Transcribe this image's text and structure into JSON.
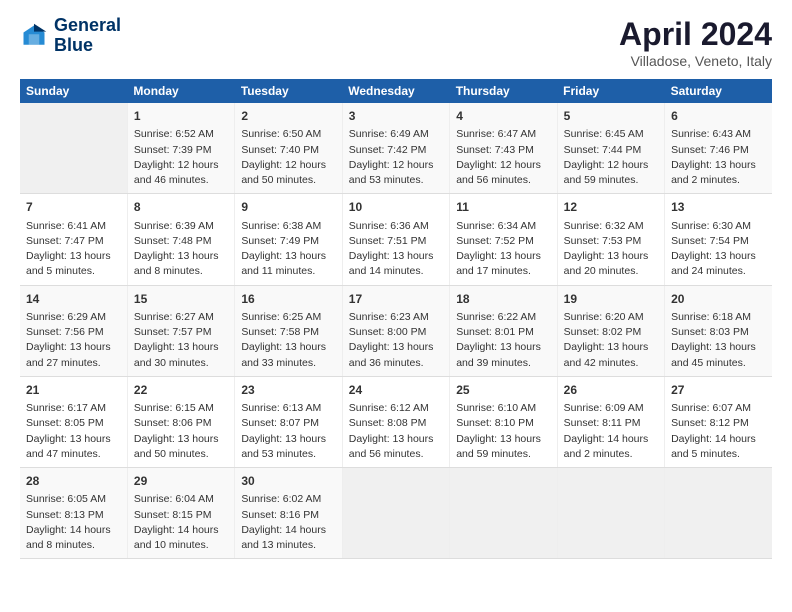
{
  "logo": {
    "line1": "General",
    "line2": "Blue"
  },
  "title": "April 2024",
  "subtitle": "Villadose, Veneto, Italy",
  "days_of_week": [
    "Sunday",
    "Monday",
    "Tuesday",
    "Wednesday",
    "Thursday",
    "Friday",
    "Saturday"
  ],
  "weeks": [
    [
      {
        "day": "",
        "sunrise": "",
        "sunset": "",
        "daylight": ""
      },
      {
        "day": "1",
        "sunrise": "Sunrise: 6:52 AM",
        "sunset": "Sunset: 7:39 PM",
        "daylight": "Daylight: 12 hours and 46 minutes."
      },
      {
        "day": "2",
        "sunrise": "Sunrise: 6:50 AM",
        "sunset": "Sunset: 7:40 PM",
        "daylight": "Daylight: 12 hours and 50 minutes."
      },
      {
        "day": "3",
        "sunrise": "Sunrise: 6:49 AM",
        "sunset": "Sunset: 7:42 PM",
        "daylight": "Daylight: 12 hours and 53 minutes."
      },
      {
        "day": "4",
        "sunrise": "Sunrise: 6:47 AM",
        "sunset": "Sunset: 7:43 PM",
        "daylight": "Daylight: 12 hours and 56 minutes."
      },
      {
        "day": "5",
        "sunrise": "Sunrise: 6:45 AM",
        "sunset": "Sunset: 7:44 PM",
        "daylight": "Daylight: 12 hours and 59 minutes."
      },
      {
        "day": "6",
        "sunrise": "Sunrise: 6:43 AM",
        "sunset": "Sunset: 7:46 PM",
        "daylight": "Daylight: 13 hours and 2 minutes."
      }
    ],
    [
      {
        "day": "7",
        "sunrise": "Sunrise: 6:41 AM",
        "sunset": "Sunset: 7:47 PM",
        "daylight": "Daylight: 13 hours and 5 minutes."
      },
      {
        "day": "8",
        "sunrise": "Sunrise: 6:39 AM",
        "sunset": "Sunset: 7:48 PM",
        "daylight": "Daylight: 13 hours and 8 minutes."
      },
      {
        "day": "9",
        "sunrise": "Sunrise: 6:38 AM",
        "sunset": "Sunset: 7:49 PM",
        "daylight": "Daylight: 13 hours and 11 minutes."
      },
      {
        "day": "10",
        "sunrise": "Sunrise: 6:36 AM",
        "sunset": "Sunset: 7:51 PM",
        "daylight": "Daylight: 13 hours and 14 minutes."
      },
      {
        "day": "11",
        "sunrise": "Sunrise: 6:34 AM",
        "sunset": "Sunset: 7:52 PM",
        "daylight": "Daylight: 13 hours and 17 minutes."
      },
      {
        "day": "12",
        "sunrise": "Sunrise: 6:32 AM",
        "sunset": "Sunset: 7:53 PM",
        "daylight": "Daylight: 13 hours and 20 minutes."
      },
      {
        "day": "13",
        "sunrise": "Sunrise: 6:30 AM",
        "sunset": "Sunset: 7:54 PM",
        "daylight": "Daylight: 13 hours and 24 minutes."
      }
    ],
    [
      {
        "day": "14",
        "sunrise": "Sunrise: 6:29 AM",
        "sunset": "Sunset: 7:56 PM",
        "daylight": "Daylight: 13 hours and 27 minutes."
      },
      {
        "day": "15",
        "sunrise": "Sunrise: 6:27 AM",
        "sunset": "Sunset: 7:57 PM",
        "daylight": "Daylight: 13 hours and 30 minutes."
      },
      {
        "day": "16",
        "sunrise": "Sunrise: 6:25 AM",
        "sunset": "Sunset: 7:58 PM",
        "daylight": "Daylight: 13 hours and 33 minutes."
      },
      {
        "day": "17",
        "sunrise": "Sunrise: 6:23 AM",
        "sunset": "Sunset: 8:00 PM",
        "daylight": "Daylight: 13 hours and 36 minutes."
      },
      {
        "day": "18",
        "sunrise": "Sunrise: 6:22 AM",
        "sunset": "Sunset: 8:01 PM",
        "daylight": "Daylight: 13 hours and 39 minutes."
      },
      {
        "day": "19",
        "sunrise": "Sunrise: 6:20 AM",
        "sunset": "Sunset: 8:02 PM",
        "daylight": "Daylight: 13 hours and 42 minutes."
      },
      {
        "day": "20",
        "sunrise": "Sunrise: 6:18 AM",
        "sunset": "Sunset: 8:03 PM",
        "daylight": "Daylight: 13 hours and 45 minutes."
      }
    ],
    [
      {
        "day": "21",
        "sunrise": "Sunrise: 6:17 AM",
        "sunset": "Sunset: 8:05 PM",
        "daylight": "Daylight: 13 hours and 47 minutes."
      },
      {
        "day": "22",
        "sunrise": "Sunrise: 6:15 AM",
        "sunset": "Sunset: 8:06 PM",
        "daylight": "Daylight: 13 hours and 50 minutes."
      },
      {
        "day": "23",
        "sunrise": "Sunrise: 6:13 AM",
        "sunset": "Sunset: 8:07 PM",
        "daylight": "Daylight: 13 hours and 53 minutes."
      },
      {
        "day": "24",
        "sunrise": "Sunrise: 6:12 AM",
        "sunset": "Sunset: 8:08 PM",
        "daylight": "Daylight: 13 hours and 56 minutes."
      },
      {
        "day": "25",
        "sunrise": "Sunrise: 6:10 AM",
        "sunset": "Sunset: 8:10 PM",
        "daylight": "Daylight: 13 hours and 59 minutes."
      },
      {
        "day": "26",
        "sunrise": "Sunrise: 6:09 AM",
        "sunset": "Sunset: 8:11 PM",
        "daylight": "Daylight: 14 hours and 2 minutes."
      },
      {
        "day": "27",
        "sunrise": "Sunrise: 6:07 AM",
        "sunset": "Sunset: 8:12 PM",
        "daylight": "Daylight: 14 hours and 5 minutes."
      }
    ],
    [
      {
        "day": "28",
        "sunrise": "Sunrise: 6:05 AM",
        "sunset": "Sunset: 8:13 PM",
        "daylight": "Daylight: 14 hours and 8 minutes."
      },
      {
        "day": "29",
        "sunrise": "Sunrise: 6:04 AM",
        "sunset": "Sunset: 8:15 PM",
        "daylight": "Daylight: 14 hours and 10 minutes."
      },
      {
        "day": "30",
        "sunrise": "Sunrise: 6:02 AM",
        "sunset": "Sunset: 8:16 PM",
        "daylight": "Daylight: 14 hours and 13 minutes."
      },
      {
        "day": "",
        "sunrise": "",
        "sunset": "",
        "daylight": ""
      },
      {
        "day": "",
        "sunrise": "",
        "sunset": "",
        "daylight": ""
      },
      {
        "day": "",
        "sunrise": "",
        "sunset": "",
        "daylight": ""
      },
      {
        "day": "",
        "sunrise": "",
        "sunset": "",
        "daylight": ""
      }
    ]
  ]
}
